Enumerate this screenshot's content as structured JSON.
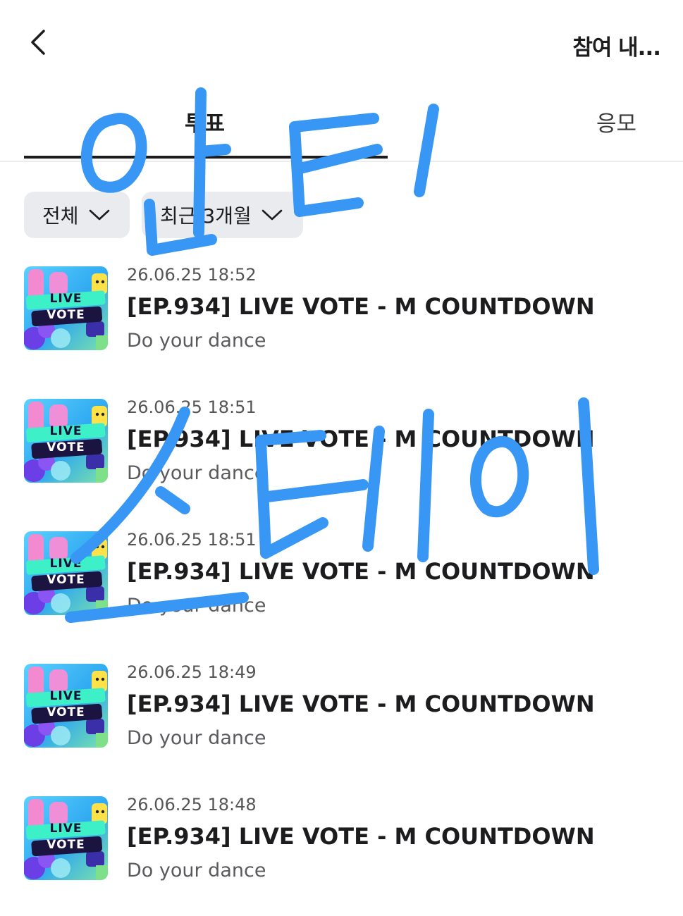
{
  "header": {
    "title": "참여 내..."
  },
  "tabs": [
    {
      "label": "투표",
      "active": true
    },
    {
      "label": "응모",
      "active": false
    }
  ],
  "filters": [
    {
      "label": "전체"
    },
    {
      "label": "최근 3개월"
    }
  ],
  "items": [
    {
      "date": "26.06.25 18:52",
      "title": "[EP.934] LIVE VOTE - M COUNTDOWN",
      "subtitle": "Do your dance"
    },
    {
      "date": "26.06.25 18:51",
      "title": "[EP.934] LIVE VOTE - M COUNTDOWN",
      "subtitle": "Do your dance"
    },
    {
      "date": "26.06.25 18:51",
      "title": "[EP.934] LIVE VOTE - M COUNTDOWN",
      "subtitle": "Do your dance"
    },
    {
      "date": "26.06.25 18:49",
      "title": "[EP.934] LIVE VOTE - M COUNTDOWN",
      "subtitle": "Do your dance"
    },
    {
      "date": "26.06.25 18:48",
      "title": "[EP.934] LIVE VOTE - M COUNTDOWN",
      "subtitle": "Do your dance"
    }
  ],
  "thumbnail": {
    "line1": "LIVE",
    "line2": "VOTE"
  },
  "handwriting": {
    "text_top": "안티",
    "text_bottom": "스테이",
    "color": "#3896f5"
  }
}
